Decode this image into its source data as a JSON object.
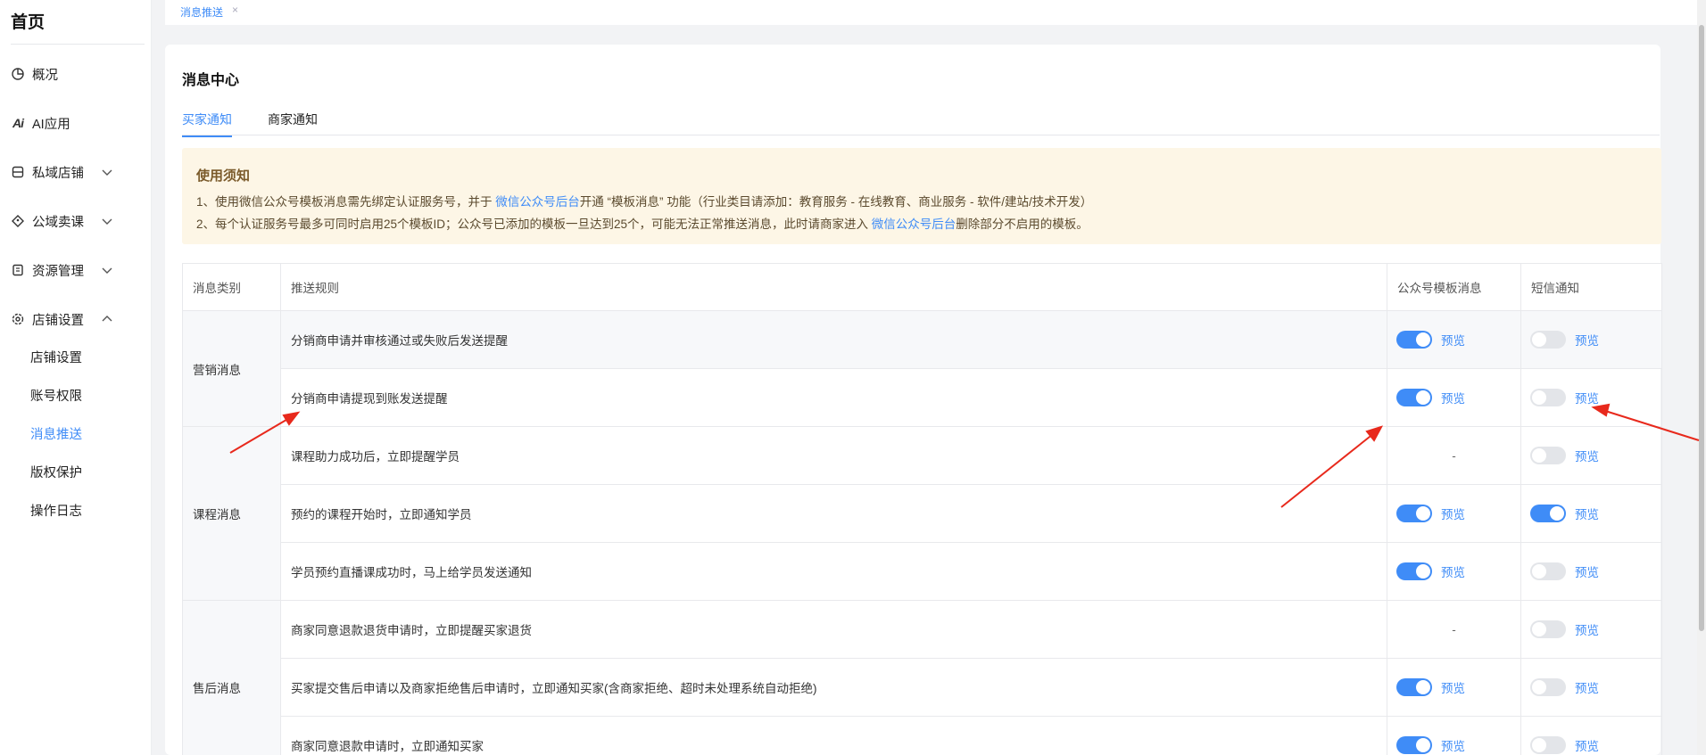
{
  "sidebar": {
    "title": "首页",
    "items": [
      {
        "label": "概况",
        "icon": "pie-chart-icon"
      },
      {
        "label": "AI应用",
        "icon": "ai-logo-icon",
        "logo_text": "Ai"
      },
      {
        "label": "私域店铺",
        "icon": "store-icon",
        "expanded": false
      },
      {
        "label": "公域卖课",
        "icon": "tag-icon",
        "expanded": false
      },
      {
        "label": "资源管理",
        "icon": "resource-icon",
        "expanded": false
      },
      {
        "label": "店铺设置",
        "icon": "gear-icon",
        "expanded": true
      }
    ],
    "sub_items": [
      {
        "label": "店铺设置",
        "active": false
      },
      {
        "label": "账号权限",
        "active": false
      },
      {
        "label": "消息推送",
        "active": true
      },
      {
        "label": "版权保护",
        "active": false
      },
      {
        "label": "操作日志",
        "active": false
      }
    ]
  },
  "tagbar": {
    "tag": "消息推送",
    "close": "×"
  },
  "page": {
    "title": "消息中心",
    "tabs": [
      {
        "label": "买家通知",
        "active": true
      },
      {
        "label": "商家通知",
        "active": false
      }
    ]
  },
  "notice": {
    "title": "使用须知",
    "line1_pre": "1、使用微信公众号模板消息需先绑定认证服务号，并于 ",
    "line1_link": "微信公众号后台",
    "line1_post": "开通 “模板消息” 功能（行业类目请添加：教育服务 - 在线教育、商业服务 - 软件/建站/技术开发）",
    "line2_pre": "2、每个认证服务号最多可同时启用25个模板ID；公众号已添加的模板一旦达到25个，可能无法正常推送消息，此时请商家进入 ",
    "line2_link": "微信公众号后台",
    "line2_post": "删除部分不启用的模板。"
  },
  "table": {
    "headers": [
      "消息类别",
      "推送规则",
      "公众号模板消息",
      "短信通知"
    ],
    "preview_label": "预览",
    "dash": "-",
    "groups": [
      {
        "category": "营销消息",
        "rows": [
          {
            "rule": "分销商申请并审核通过或失败后发送提醒",
            "wechat": "on",
            "sms": "off"
          },
          {
            "rule": "分销商申请提现到账发送提醒",
            "wechat": "on",
            "sms": "off"
          }
        ]
      },
      {
        "category": "课程消息",
        "rows": [
          {
            "rule": "课程助力成功后，立即提醒学员",
            "wechat": "none",
            "sms": "off"
          },
          {
            "rule": "预约的课程开始时，立即通知学员",
            "wechat": "on",
            "sms": "on"
          },
          {
            "rule": "学员预约直播课成功时，马上给学员发送通知",
            "wechat": "on",
            "sms": "off"
          }
        ]
      },
      {
        "category": "售后消息",
        "rows": [
          {
            "rule": "商家同意退款退货申请时，立即提醒买家退货",
            "wechat": "none",
            "sms": "off"
          },
          {
            "rule": "买家提交售后申请以及商家拒绝售后申请时，立即通知买家(含商家拒绝、超时未处理系统自动拒绝)",
            "wechat": "on",
            "sms": "off"
          },
          {
            "rule": "商家同意退款申请时，立即通知买家",
            "wechat": "on",
            "sms": "off"
          }
        ]
      }
    ]
  },
  "colors": {
    "accent": "#3f8cf7",
    "notice_bg": "#fdf6e6",
    "annotation_arrow": "#e8291c"
  }
}
